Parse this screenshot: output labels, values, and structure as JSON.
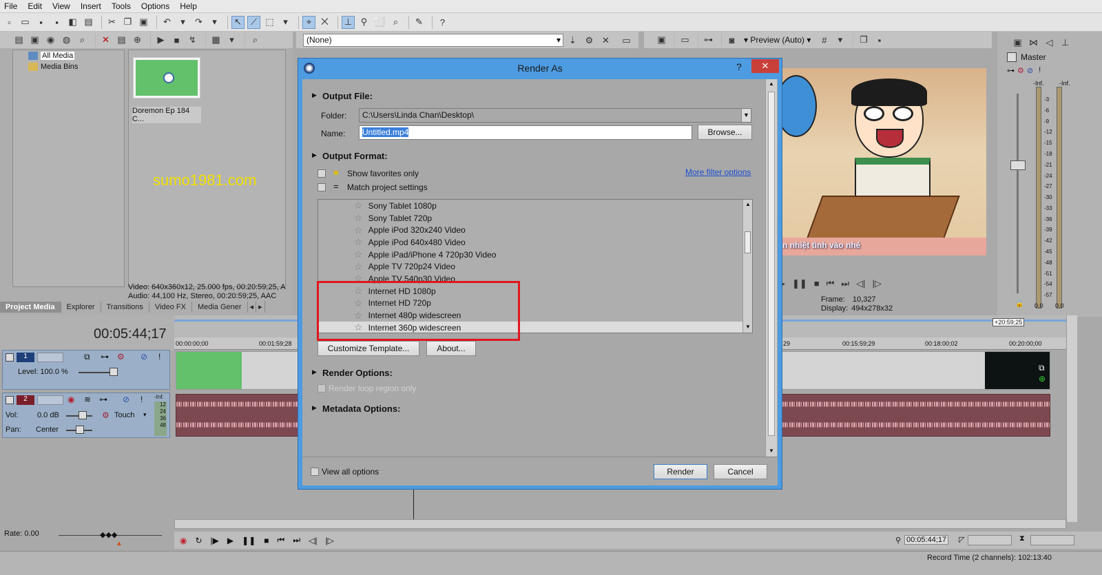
{
  "menu": [
    "File",
    "Edit",
    "View",
    "Insert",
    "Tools",
    "Options",
    "Help"
  ],
  "project_media": {
    "tree": [
      "All Media",
      "Media Bins"
    ],
    "thumb_label": "Doremon Ep 184 C...",
    "watermark": "sumo1981.com",
    "info_line1": "Video: 640x360x12, 25.000 fps, 00:20:59;25, A",
    "info_line2": "Audio: 44,100 Hz, Stereo, 00:20:59;25, AAC",
    "tabs": [
      "Project Media",
      "Explorer",
      "Transitions",
      "Video FX",
      "Media Gener"
    ]
  },
  "video_fx_dropdown": "(None)",
  "preview": {
    "label": "Preview (Auto)",
    "frame_label": "Frame:",
    "frame_value": "10,327",
    "display_label": "Display:",
    "display_value": "494x278x32",
    "subtitle": "n nhiệt tình vào nhé"
  },
  "master": {
    "title": "Master",
    "left_inf": "-Inf.",
    "right_inf": "-Inf.",
    "scale": [
      "3",
      "6",
      "9",
      "12",
      "15",
      "18",
      "21",
      "24",
      "27",
      "30",
      "33",
      "36",
      "39",
      "42",
      "45",
      "48",
      "51",
      "54",
      "57"
    ],
    "bottom_left": "0.0",
    "bottom_right": "0.0"
  },
  "timeline": {
    "timecode": "00:05:44;17",
    "ruler_marks": [
      "00:00:00;00",
      "00:01:59;28",
      "29",
      "00:15:59;29",
      "00:18:00;02",
      "00:20:00;00"
    ],
    "end_marker": "+20:59;25",
    "track1": {
      "num": "1",
      "level_label": "Level: 100.0 %"
    },
    "track2": {
      "num": "2",
      "vol_label": "Vol:",
      "vol_value": "0.0 dB",
      "pan_label": "Pan:",
      "pan_value": "Center",
      "mode": "Touch",
      "meter_top": "-Inf.",
      "meter_marks": [
        "12",
        "24",
        "36",
        "48"
      ]
    },
    "rate_label": "Rate: 0.00",
    "transport_time": "00:05:44;17",
    "record_time": "Record Time (2 channels): 102:13:40"
  },
  "dialog": {
    "title": "Render As",
    "help": "?",
    "close": "✕",
    "output_file_header": "Output File:",
    "folder_label": "Folder:",
    "folder_value": "C:\\Users\\Linda Chan\\Desktop\\",
    "name_label": "Name:",
    "name_value": "Untitled.mp4",
    "browse": "Browse...",
    "output_format_header": "Output Format:",
    "show_favorites": "Show favorites only",
    "match_project": "Match project settings",
    "more_filter": "More filter options",
    "formats": [
      "Sony Tablet 1080p",
      "Sony Tablet 720p",
      "Apple iPod 320x240 Video",
      "Apple iPod 640x480 Video",
      "Apple iPad/iPhone 4 720p30 Video",
      "Apple TV 720p24 Video",
      "Apple TV 540p30 Video",
      "Internet HD 1080p",
      "Internet HD 720p",
      "Internet 480p widescreen",
      "Internet 360p widescreen"
    ],
    "selected_format": "Internet 360p widescreen",
    "customize": "Customize Template...",
    "about": "About...",
    "render_options_header": "Render Options:",
    "render_loop": "Render loop region only",
    "metadata_header": "Metadata Options:",
    "view_all": "View all options",
    "render_btn": "Render",
    "cancel_btn": "Cancel",
    "highlight_color": "#e0161d"
  }
}
